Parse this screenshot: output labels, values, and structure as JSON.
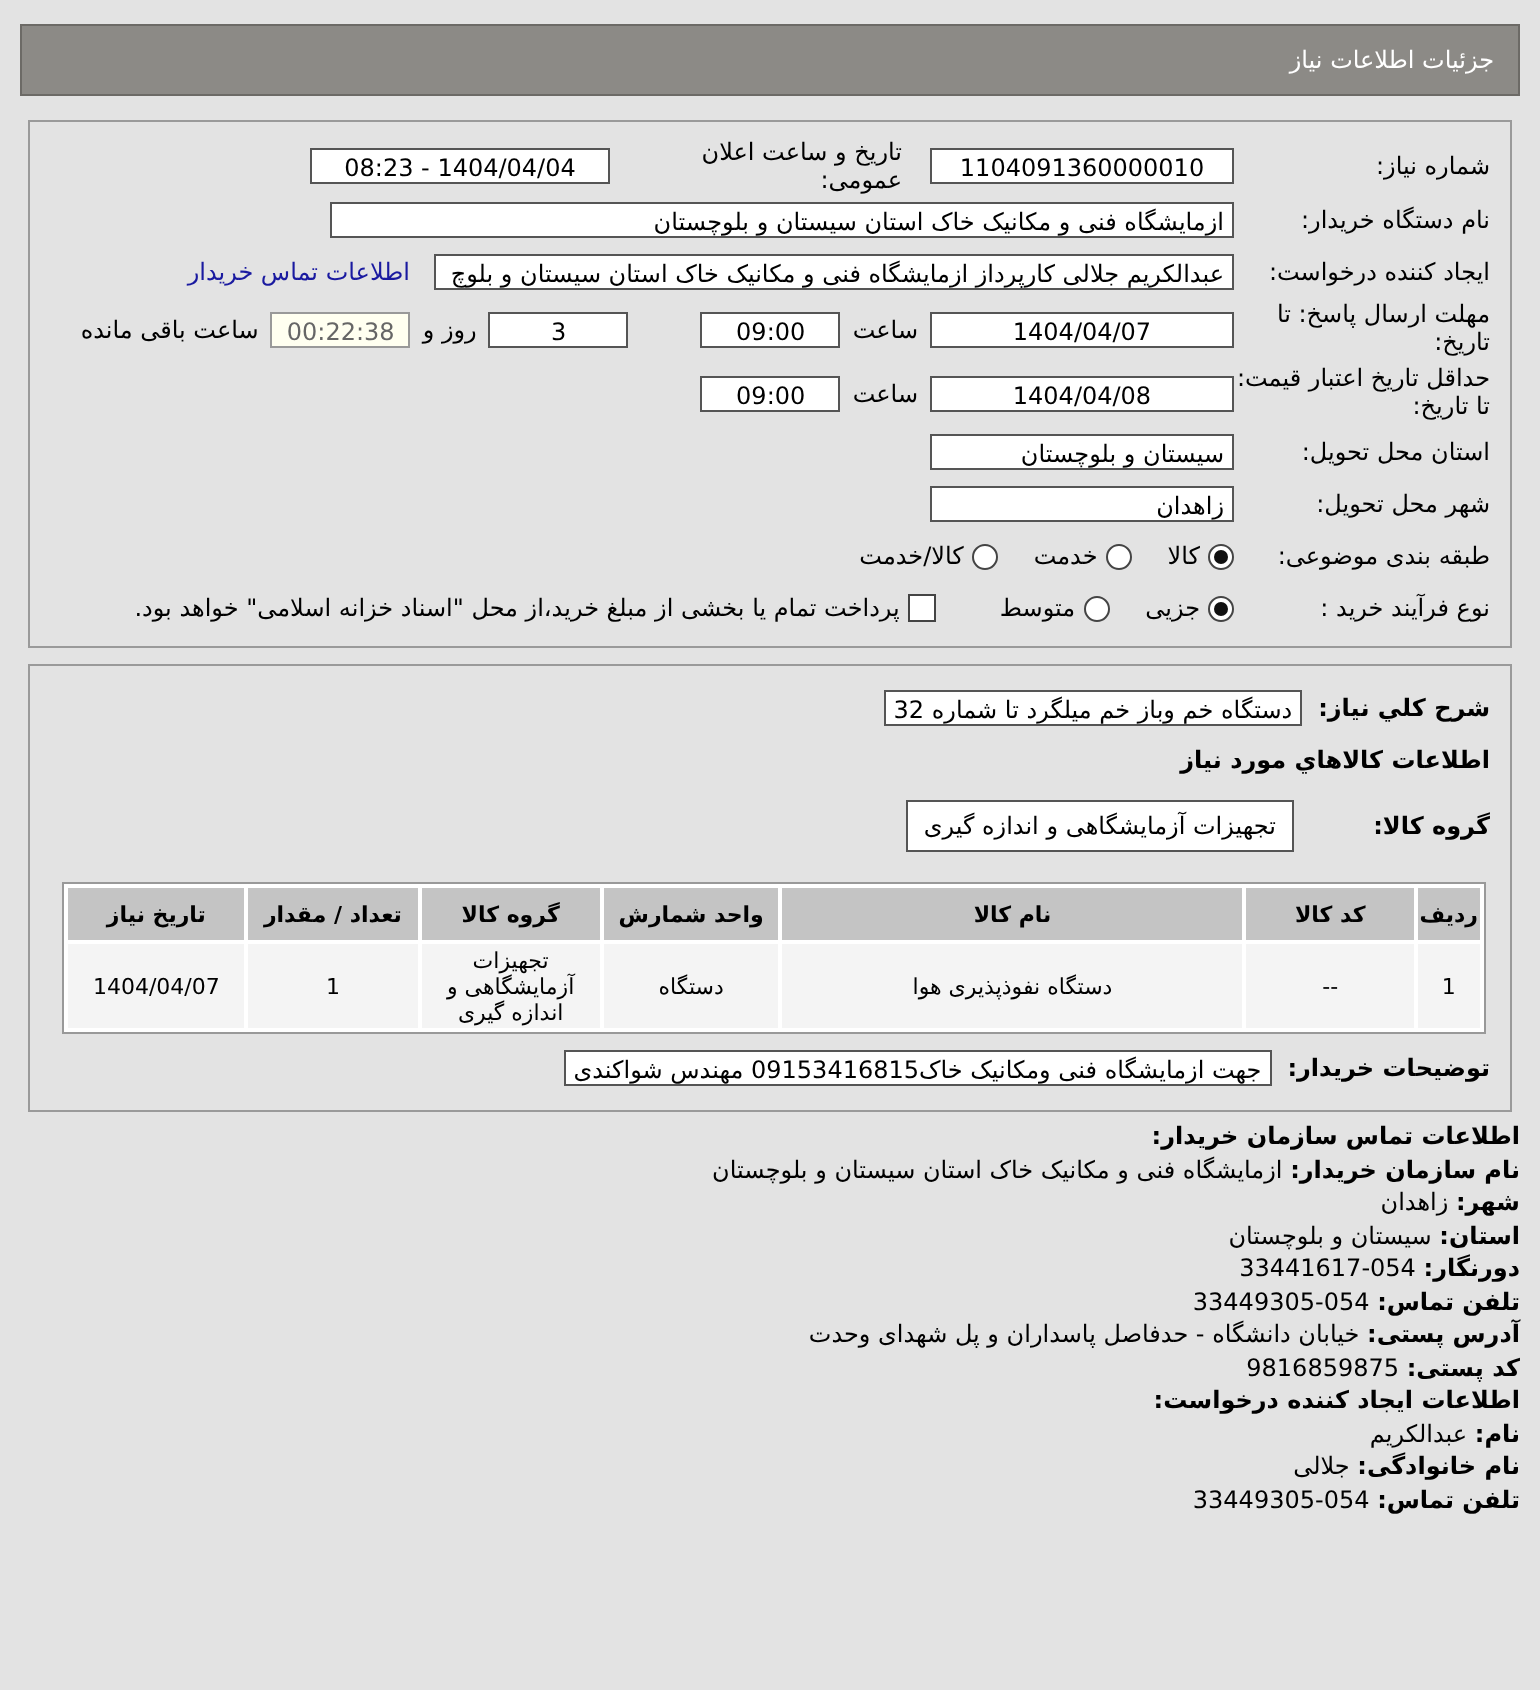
{
  "header": {
    "title": "جزئیات اطلاعات نیاز"
  },
  "need": {
    "number_label": "شماره نیاز:",
    "number": "1104091360000010",
    "announce_label": "تاریخ و ساعت اعلان عمومی:",
    "announce": "1404/04/04 - 08:23",
    "buyer_label": "نام دستگاه خریدار:",
    "buyer": "ازمایشگاه فنی و مکانیک خاک استان سیستان و بلوچستان",
    "creator_label": "ایجاد کننده درخواست:",
    "creator": "عبدالکریم جلالی کارپرداز ازمایشگاه فنی و مکانیک خاک استان سیستان و بلوچ",
    "contact_link": "اطلاعات تماس خریدار",
    "deadline_label": "مهلت ارسال پاسخ: تا تاریخ:",
    "deadline_date": "1404/04/07",
    "deadline_time_label": "ساعت",
    "deadline_time": "09:00",
    "days": "3",
    "days_label": "روز و",
    "remaining": "00:22:38",
    "remaining_label": "ساعت باقی مانده",
    "validity_label": "حداقل تاریخ اعتبار قیمت: تا تاریخ:",
    "validity_date": "1404/04/08",
    "validity_time_label": "ساعت",
    "validity_time": "09:00",
    "province_label": "استان محل تحویل:",
    "province": "سیستان و بلوچستان",
    "city_label": "شهر محل تحویل:",
    "city": "زاهدان",
    "category_label": "طبقه بندی موضوعی:",
    "categories": [
      {
        "label": "کالا",
        "selected": true
      },
      {
        "label": "خدمت",
        "selected": false
      },
      {
        "label": "کالا/خدمت",
        "selected": false
      }
    ],
    "process_label": "نوع فرآیند خرید :",
    "processes": [
      {
        "label": "جزیی",
        "selected": true
      },
      {
        "label": "متوسط",
        "selected": false
      }
    ],
    "payment": {
      "checked": false,
      "label": "پرداخت تمام یا بخشی از مبلغ خرید،از محل \"اسناد خزانه اسلامی\" خواهد بود."
    }
  },
  "items": {
    "description_label": "شرح کلي نياز:",
    "description": "دستگاه خم وباز خم میلگرد تا شماره 32",
    "goods_title": "اطلاعات کالاهاي مورد نياز",
    "group_label": "گروه کالا:",
    "group": "تجهیزات آزمایشگاهی و اندازه گیری",
    "table": {
      "columns": [
        "ردیف",
        "کد کالا",
        "نام کالا",
        "واحد شمارش",
        "گروه کالا",
        "تعداد / مقدار",
        "تاریخ نیاز"
      ],
      "rows": [
        [
          "1",
          "--",
          "دستگاه نفوذپذیری هوا",
          "دستگاه",
          "تجهیزات آزمایشگاهی و اندازه گیری",
          "1",
          "1404/04/07"
        ]
      ]
    },
    "notes_label": "توضیحات خریدار:",
    "notes": "جهت ازمایشگاه فنی ومکانیک خاک09153416815 مهندس شواکندی"
  },
  "contact": {
    "title": "اطلاعات تماس سازمان خریدار:",
    "lines": [
      {
        "label": "نام سازمان خریدار:",
        "value": "ازمایشگاه فنی و مکانیک خاک استان سیستان و بلوچستان"
      },
      {
        "label": "شهر:",
        "value": "زاهدان"
      },
      {
        "label": "استان:",
        "value": "سیستان و بلوچستان"
      },
      {
        "label": "دورنگار:",
        "value": "054-33441617"
      },
      {
        "label": "تلفن تماس:",
        "value": "054-33449305"
      },
      {
        "label": "آدرس پستی:",
        "value": "خیابان دانشگاه - حدفاصل پاسداران و پل شهدای وحدت"
      },
      {
        "label": "کد پستی:",
        "value": "9816859875"
      }
    ],
    "creator_title": "اطلاعات ایجاد کننده درخواست:",
    "creator_lines": [
      {
        "label": "نام:",
        "value": "عبدالکریم"
      },
      {
        "label": "نام خانوادگی:",
        "value": "جلالی"
      },
      {
        "label": "تلفن تماس:",
        "value": "054-33449305"
      }
    ]
  }
}
